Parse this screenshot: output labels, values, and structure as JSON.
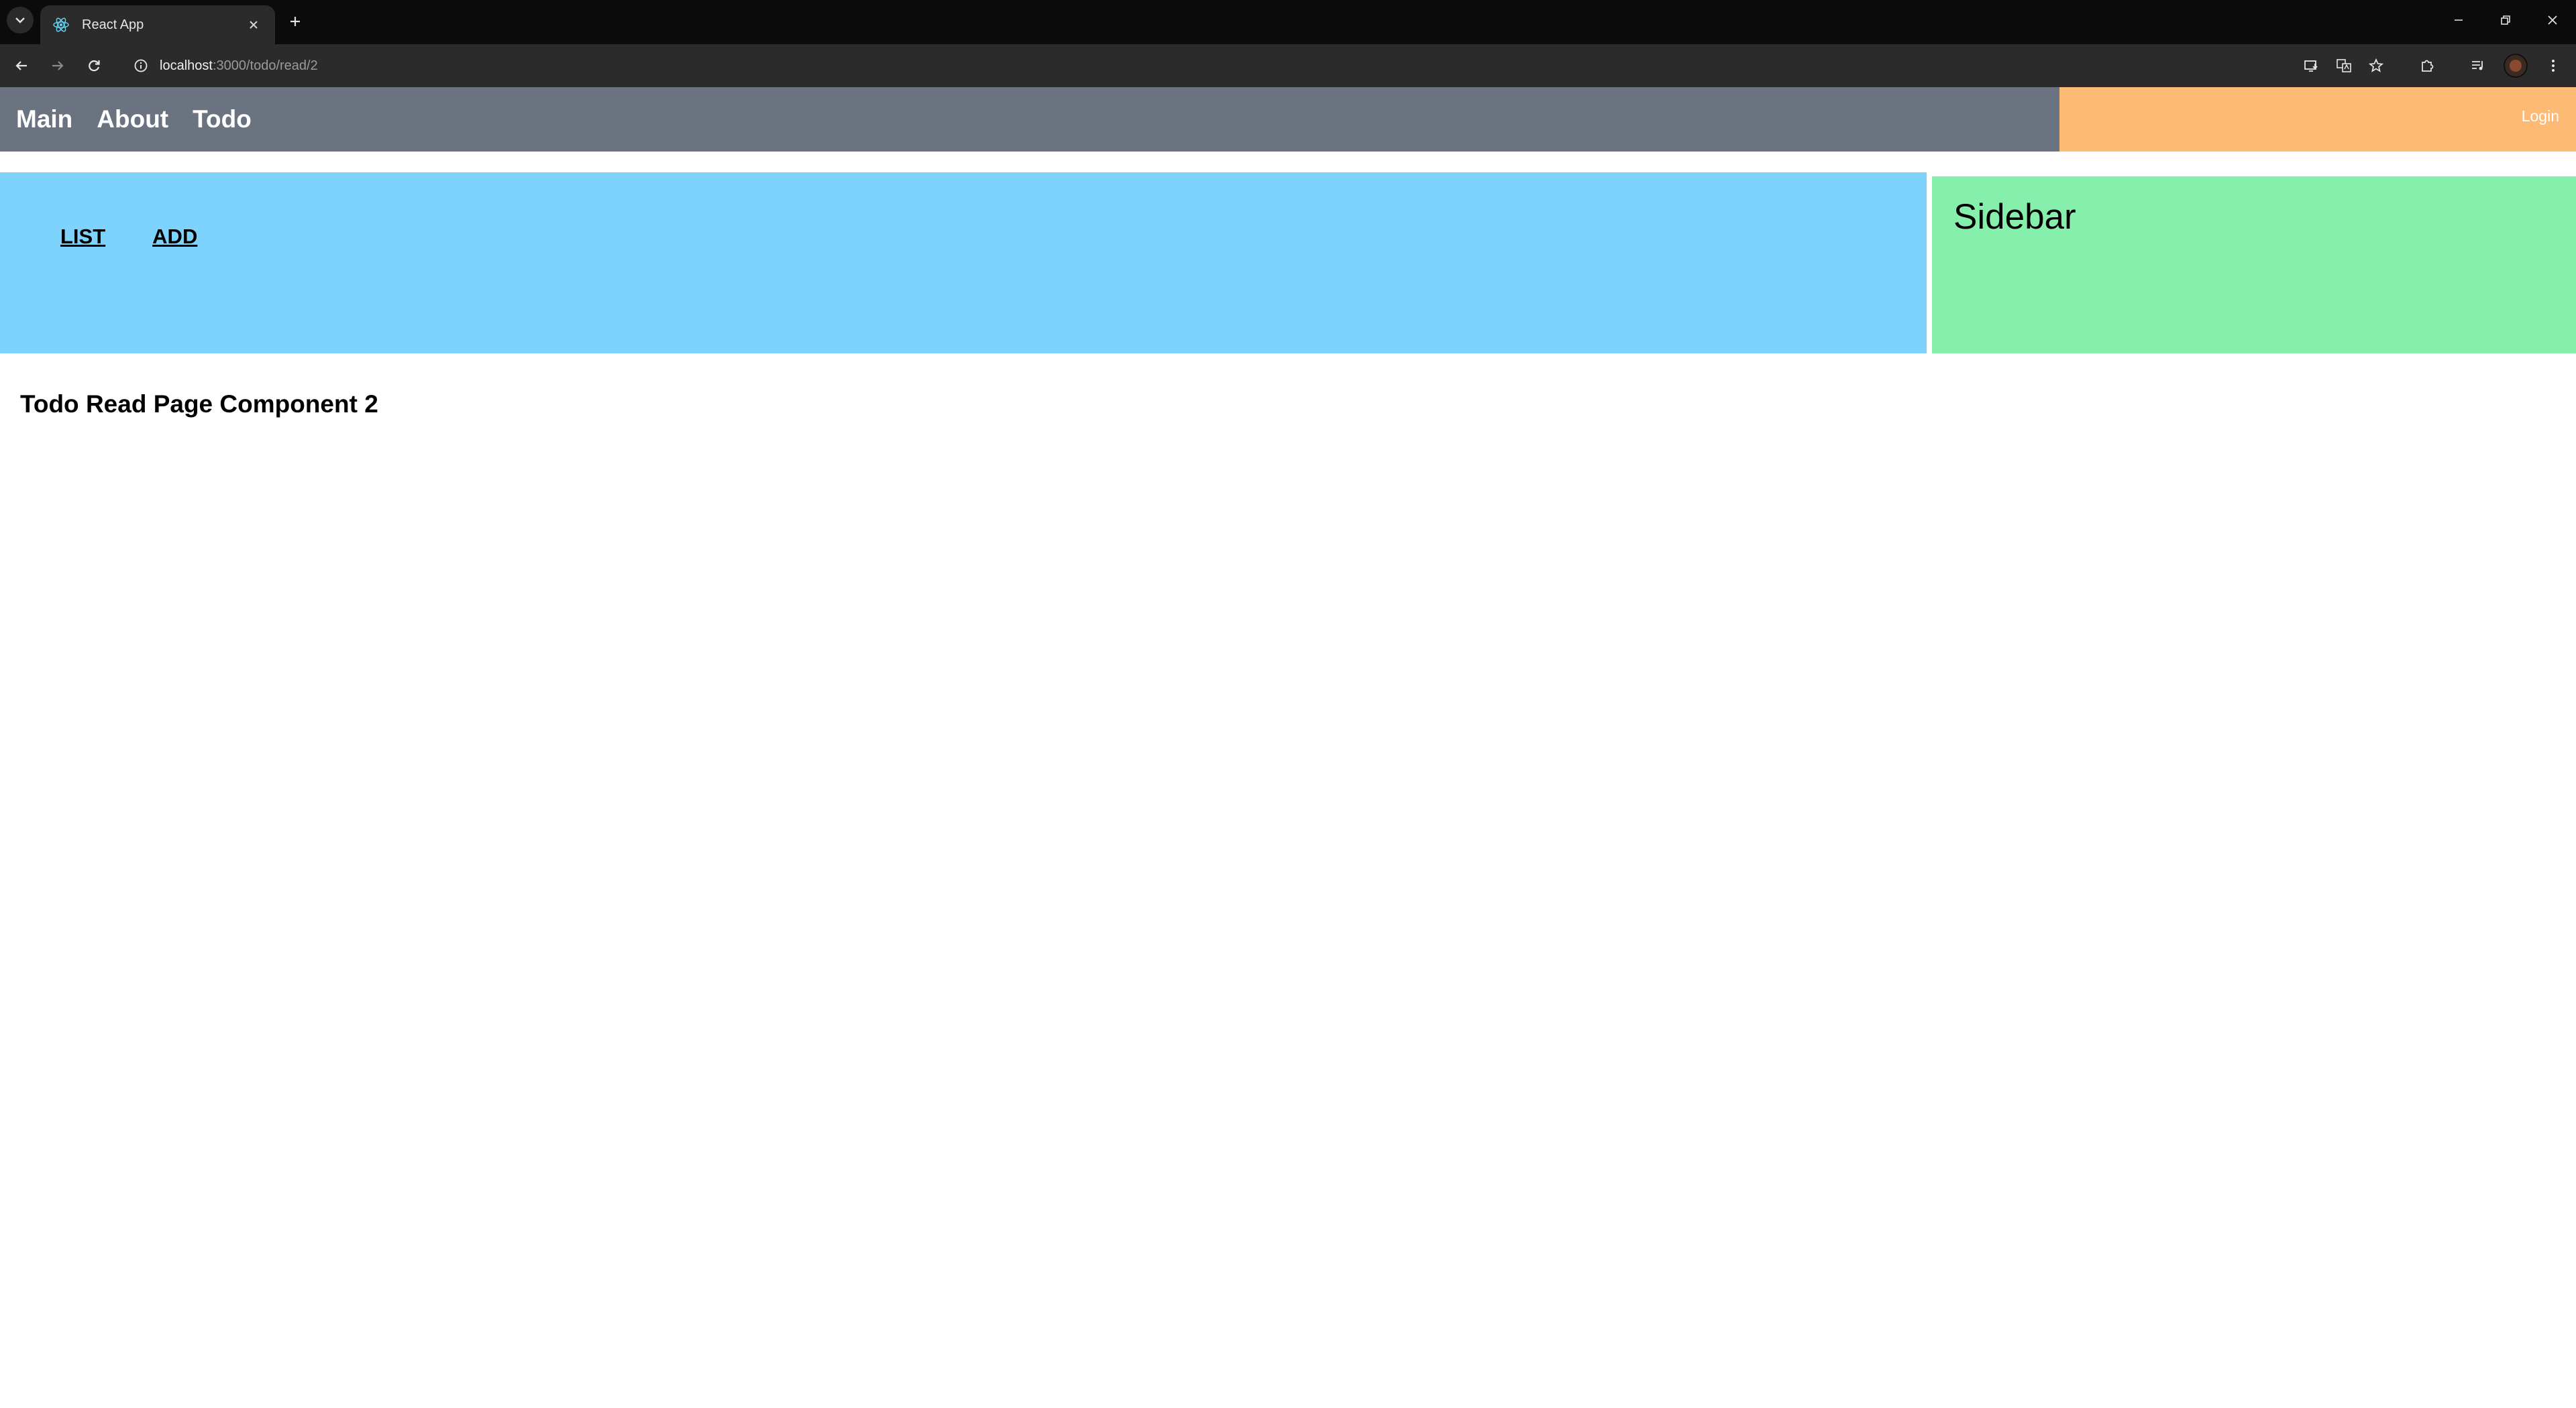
{
  "browser": {
    "tab": {
      "title": "React App"
    },
    "address": {
      "host": "localhost",
      "path": ":3000/todo/read/2"
    }
  },
  "app": {
    "nav": {
      "items": [
        {
          "label": "Main"
        },
        {
          "label": "About"
        },
        {
          "label": "Todo"
        }
      ]
    },
    "login_label": "Login",
    "submenu": {
      "list_label": "LIST",
      "add_label": "ADD"
    },
    "read_title": "Todo Read Page Component 2",
    "sidebar_title": "Sidebar"
  },
  "colors": {
    "nav_bg": "#6b7280",
    "login_bg": "#fdba74",
    "main_bg": "#7dd3fc",
    "sidebar_bg": "#86efac"
  },
  "icons": {
    "tab_search": "chevron-down-icon",
    "favicon": "react-icon",
    "tab_close": "close-icon",
    "new_tab": "plus-icon",
    "back": "arrow-left-icon",
    "forward": "arrow-right-icon",
    "reload": "reload-icon",
    "site_info": "info-icon",
    "install": "install-app-icon",
    "translate": "translate-icon",
    "bookmark": "star-icon",
    "extensions": "puzzle-icon",
    "media": "media-controls-icon",
    "menu": "kebab-menu-icon"
  }
}
